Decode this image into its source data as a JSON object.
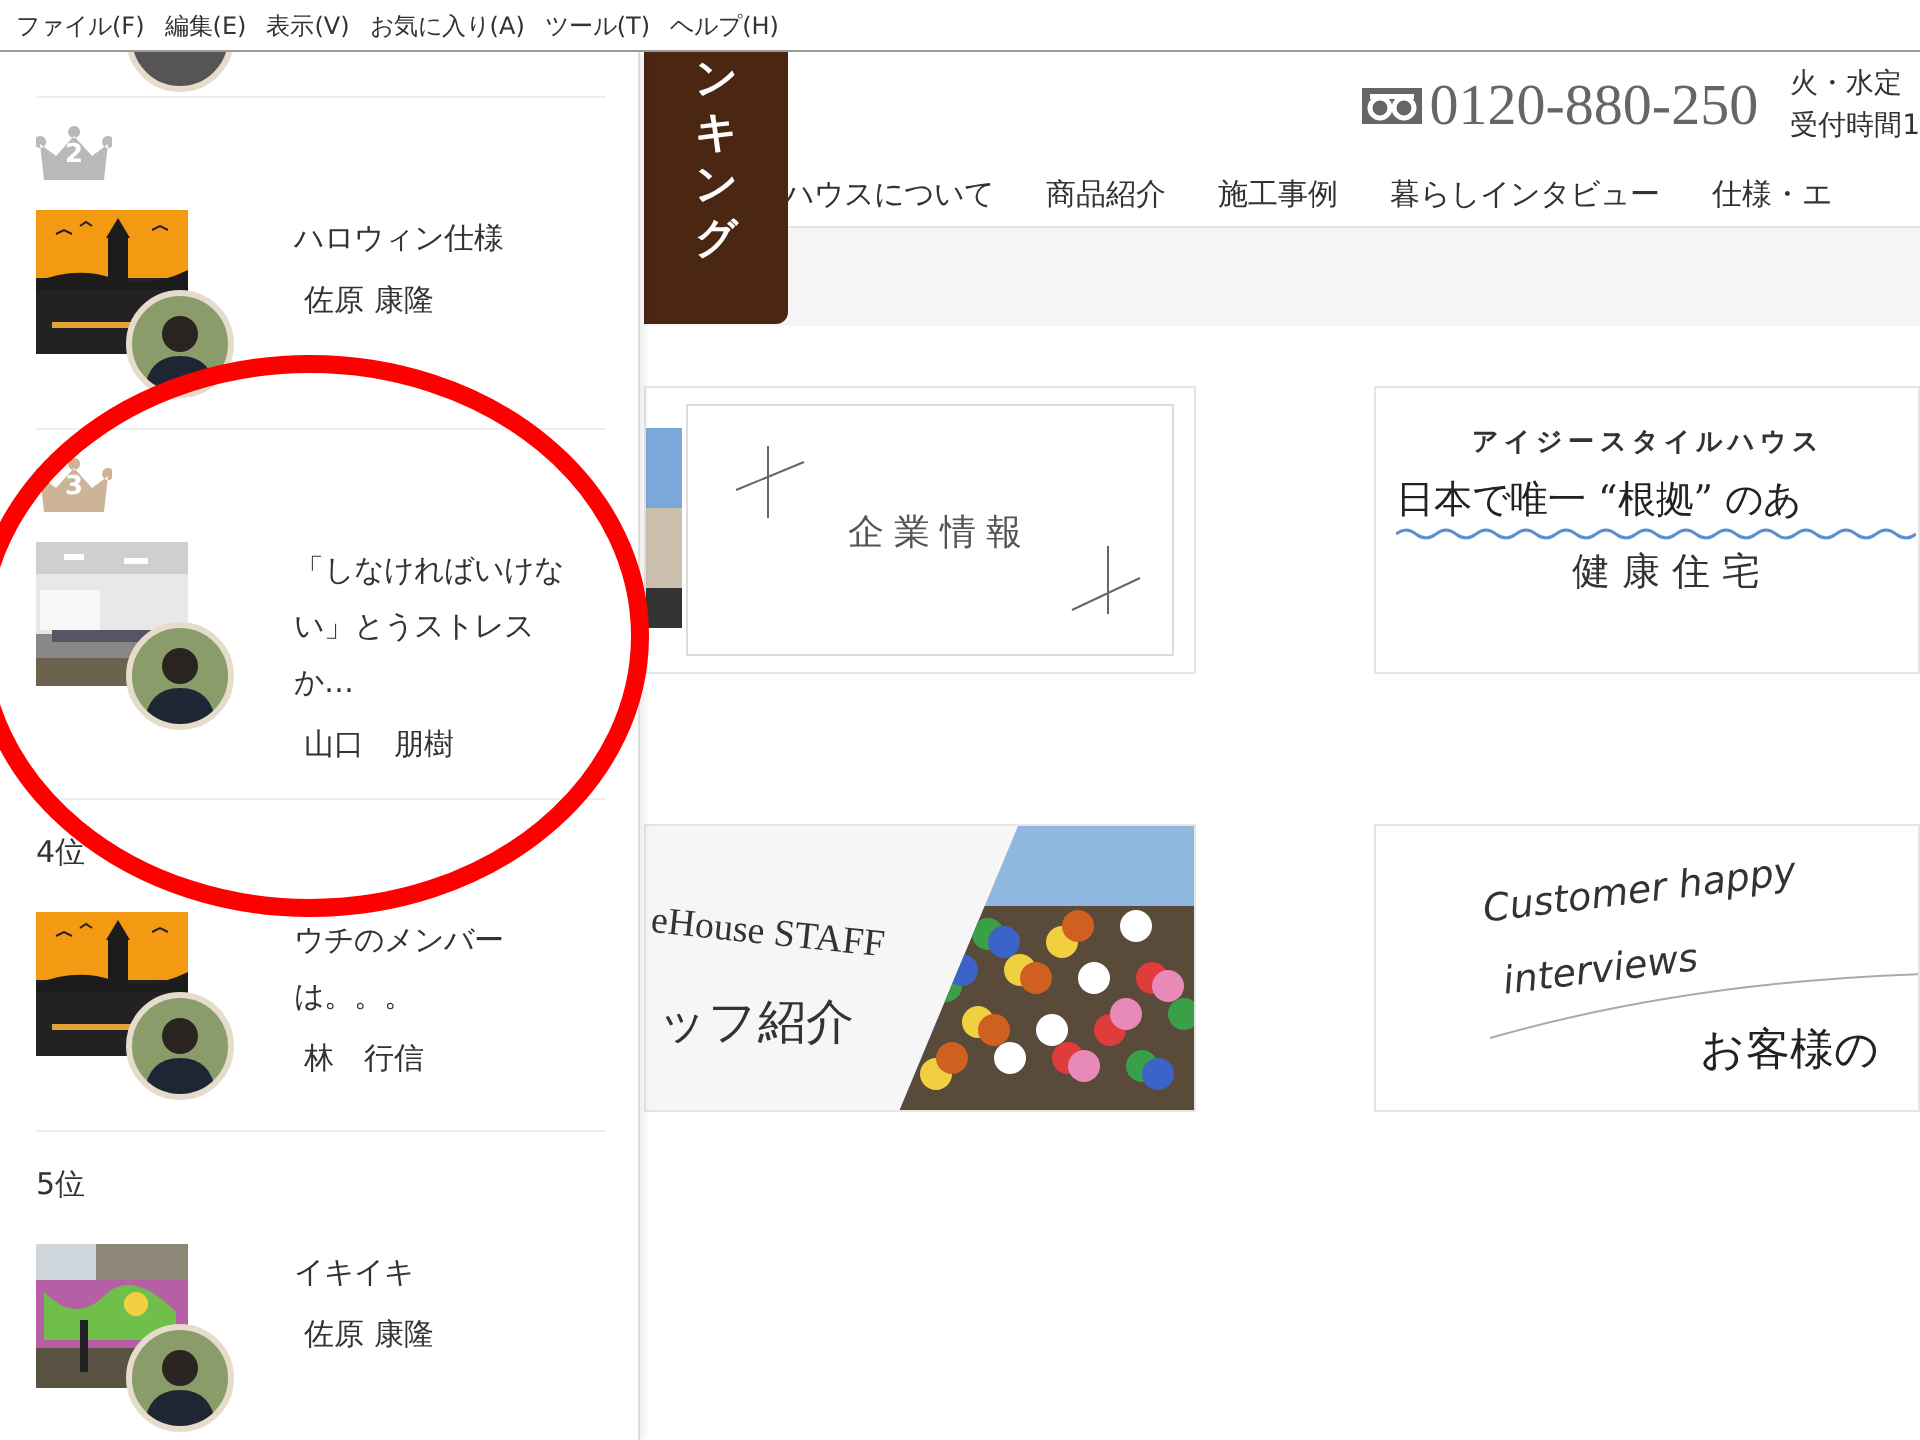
{
  "menu_bar": {
    "items": [
      "ファイル(F)",
      "編集(E)",
      "表示(V)",
      "お気に入り(A)",
      "ツール(T)",
      "ヘルプ(H)"
    ]
  },
  "ranking_panel": {
    "items": [
      {
        "kind": "crown",
        "rank": "2",
        "color": "#b9b9b9",
        "title": "ハロウィン仕様",
        "author": "佐原 康隆"
      },
      {
        "kind": "crown",
        "rank": "3",
        "color": "#cdb497",
        "title": "「しなければいけない」とうストレスか…",
        "author": "山口　朋樹"
      },
      {
        "kind": "text",
        "rank": "4位",
        "title": "ウチのメンバーは。。。",
        "author": "林　行信"
      },
      {
        "kind": "text",
        "rank": "5位",
        "title": "イキイキ",
        "author": "佐原 康隆"
      }
    ]
  },
  "header": {
    "ranking_tab": "ンキング",
    "phone": "0120-880-250",
    "hours": [
      "火・水定",
      "受付時間1"
    ],
    "nav": [
      "ハウスについて",
      "商品紹介",
      "施工事例",
      "暮らしインタビュー",
      "仕様・エ"
    ]
  },
  "banners": [
    {
      "kind": "company",
      "title": "企業情報"
    },
    {
      "kind": "health",
      "eyebrow": "アイジースタイルハウス",
      "headline": "日本で唯一 “根拠” のあ",
      "subtitle": "健康住宅"
    },
    {
      "kind": "staff",
      "english": "eHouse STAFF",
      "title": "ッフ紹介"
    },
    {
      "kind": "interview",
      "english": [
        "Customer happy",
        "interviews"
      ],
      "title": "お客様の"
    }
  ],
  "annotation": {
    "kind": "ellipse",
    "color": "#ff0000"
  }
}
